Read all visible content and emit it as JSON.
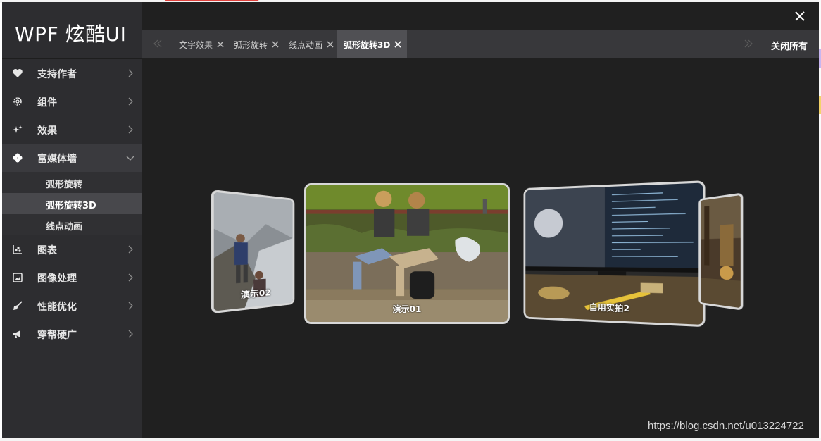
{
  "app": {
    "title": "WPF 炫酷UI"
  },
  "sidebar": {
    "items": [
      {
        "label": "支持作者",
        "icon": "heart-icon"
      },
      {
        "label": "组件",
        "icon": "gear-icon"
      },
      {
        "label": "效果",
        "icon": "sparkle-icon"
      },
      {
        "label": "富媒体墙",
        "icon": "clover-icon",
        "expanded": true,
        "children": [
          {
            "label": "弧形旋转"
          },
          {
            "label": "弧形旋转3D",
            "selected": true
          },
          {
            "label": "线点动画"
          }
        ]
      },
      {
        "label": "图表",
        "icon": "chart-icon"
      },
      {
        "label": "图像处理",
        "icon": "image-icon"
      },
      {
        "label": "性能优化",
        "icon": "broom-icon"
      },
      {
        "label": "穿帮硬广",
        "icon": "megaphone-icon"
      }
    ]
  },
  "tabs": {
    "items": [
      {
        "label": "文字效果"
      },
      {
        "label": "弧形旋转"
      },
      {
        "label": "线点动画"
      },
      {
        "label": "弧形旋转3D",
        "active": true
      }
    ],
    "close_all": "关闭所有"
  },
  "carousel": {
    "cards": [
      {
        "caption": "演示02"
      },
      {
        "caption": "演示01"
      },
      {
        "caption": "自用实拍2"
      },
      {
        "caption": ""
      }
    ]
  },
  "watermark": "https://blog.csdn.net/u013224722",
  "colors": {
    "sidebar_bg": "#2d2d30",
    "content_bg": "#202020",
    "tabbar_bg": "#38383b",
    "active_tab_bg": "#505054"
  }
}
